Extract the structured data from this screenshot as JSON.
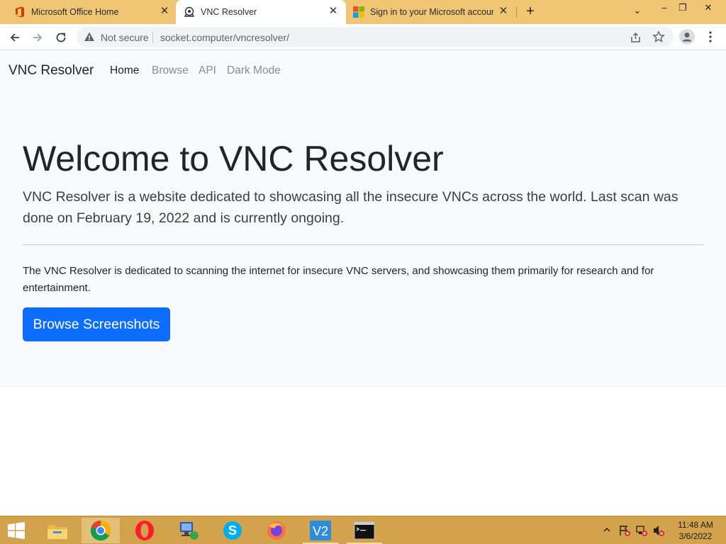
{
  "browser": {
    "tabs": [
      {
        "title": "Microsoft Office Home",
        "icon": "office-icon",
        "active": false
      },
      {
        "title": "VNC Resolver",
        "icon": "vnc-resolver-favicon",
        "active": true
      },
      {
        "title": "Sign in to your Microsoft account",
        "icon": "microsoft-icon",
        "active": false
      }
    ],
    "address": {
      "security_label": "Not secure",
      "url": "socket.computer/vncresolver/"
    }
  },
  "site": {
    "brand": "VNC Resolver",
    "nav": [
      "Home",
      "Browse",
      "API",
      "Dark Mode"
    ],
    "active_nav": "Home",
    "heading": "Welcome to VNC Resolver",
    "lead": "VNC Resolver is a website dedicated to showcasing all the insecure VNCs across the world. Last scan was done on February 19, 2022 and is currently ongoing.",
    "body": "The VNC Resolver is dedicated to scanning the internet for insecure VNC servers, and showcasing them primarily for research and for entertainment.",
    "cta": "Browse Screenshots"
  },
  "taskbar": {
    "apps": [
      "start",
      "file-explorer",
      "chrome",
      "opera",
      "network-utility",
      "skype",
      "firefox",
      "vnc-viewer",
      "command-prompt"
    ],
    "clock": {
      "time": "11:48 AM",
      "date": "3/6/2022"
    }
  },
  "colors": {
    "primary": "#0d6efd",
    "tabstrip": "#f0c675",
    "taskbar": "#d2a24c",
    "jumbotron": "#f8f9fa"
  }
}
